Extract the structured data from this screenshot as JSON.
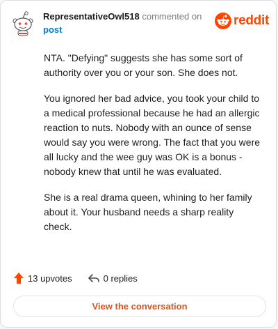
{
  "header": {
    "username": "RepresentativeOwl518",
    "action": " commented on",
    "post_link": "post",
    "logo_text": "reddit"
  },
  "comment": {
    "paragraphs": [
      "NTA. \"Defying\" suggests she has some sort of authority over you or your son. She does not.",
      "You ignored her bad advice, you took your child to a medical professional because he had an allergic reaction to nuts. Nobody with an ounce of sense would say you were wrong. The fact that you were all lucky and the wee guy was OK is a bonus - nobody knew that until he was evaluated.",
      "She is a real drama queen, whining to her family about it. Your husband needs a sharp reality check."
    ]
  },
  "footer": {
    "upvotes": "13 upvotes",
    "replies": "0 replies",
    "view_button": "View the conversation"
  },
  "colors": {
    "brand": "#ff4500",
    "link": "#0079d3",
    "button_text": "#d9541e"
  },
  "icons": {
    "avatar": "snoo-avatar",
    "logo": "reddit-logo-icon",
    "upvote": "upvote-arrow-icon",
    "reply": "reply-arrow-icon"
  }
}
